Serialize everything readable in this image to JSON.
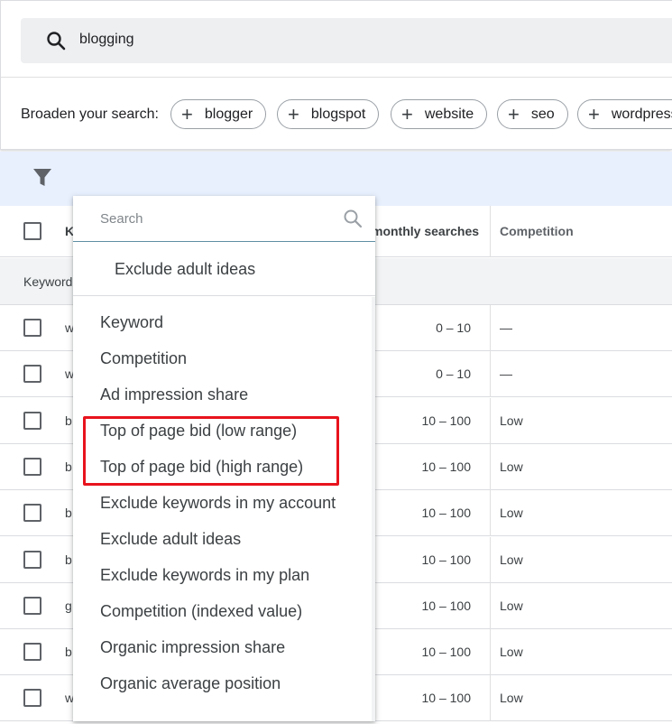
{
  "search": {
    "query": "blogging"
  },
  "broaden": {
    "label": "Broaden your search:",
    "chips": [
      "blogger",
      "blogspot",
      "website",
      "seo",
      "wordpress"
    ]
  },
  "table": {
    "headers": {
      "keyword": "K",
      "avg_searches": "monthly searches",
      "competition": "Competition"
    },
    "group_label": "Keyword",
    "rows": [
      {
        "kw": "w",
        "searches": "0 – 10",
        "competition": "—"
      },
      {
        "kw": "w",
        "searches": "0 – 10",
        "competition": "—"
      },
      {
        "kw": "b",
        "searches": "10 – 100",
        "competition": "Low"
      },
      {
        "kw": "b",
        "searches": "10 – 100",
        "competition": "Low"
      },
      {
        "kw": "b",
        "searches": "10 – 100",
        "competition": "Low"
      },
      {
        "kw": "b",
        "searches": "10 – 100",
        "competition": "Low"
      },
      {
        "kw": "g",
        "searches": "10 – 100",
        "competition": "Low"
      },
      {
        "kw": "b",
        "searches": "10 – 100",
        "competition": "Low"
      },
      {
        "kw": "w",
        "searches": "10 – 100",
        "competition": "Low"
      }
    ]
  },
  "dropdown": {
    "search_placeholder": "Search",
    "selected_item": "Exclude adult ideas",
    "items": [
      "Keyword",
      "Competition",
      "Ad impression share",
      "Top of page bid (low range)",
      "Top of page bid (high range)",
      "Exclude keywords in my account",
      "Exclude adult ideas",
      "Exclude keywords in my plan",
      "Competition (indexed value)",
      "Organic impression share",
      "Organic average position"
    ]
  },
  "colors": {
    "highlight": "#e8131d",
    "filter_bar": "#e8f0fe"
  }
}
